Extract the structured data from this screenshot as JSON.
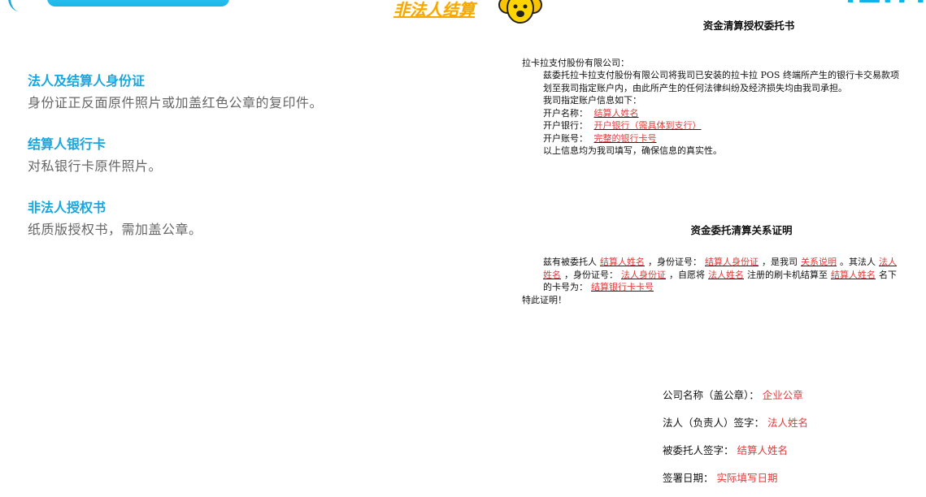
{
  "header": {
    "logo_text": "非法人结算",
    "right_fragment": "IEI7I"
  },
  "requirements": [
    {
      "title": "法人及结算人身份证",
      "desc": "身份证正反面原件照片或加盖红色公章的复印件。"
    },
    {
      "title": "结算人银行卡",
      "desc": "对私银行卡原件照片。"
    },
    {
      "title": "非法人授权书",
      "desc": "纸质版授权书，需加盖公章。"
    }
  ],
  "doc1": {
    "title": "资金清算授权委托书",
    "addressee": "拉卡拉支付股份有限公司：",
    "body": "兹委托拉卡拉支付股份有限公司将我司已安装的拉卡拉 POS 终端所产生的银行卡交易款项划至我司指定账户内，由此所产生的任何法律纠纷及经济损失均由我司承担。",
    "intro": "我司指定账户信息如下：",
    "fields": [
      {
        "label": "开户名称：",
        "value": "结算人姓名"
      },
      {
        "label": "开户银行：",
        "value": "开户银行（需具体到支行）"
      },
      {
        "label": "开户账号：",
        "value": "完整的银行卡号"
      }
    ],
    "closing": "以上信息均为我司填写，确保信息的真实性。"
  },
  "doc2": {
    "title": "资金委托清算关系证明",
    "t1": "兹有被委托人",
    "v1": "结算人姓名",
    "t2": "，身份证号：",
    "v2": "结算人身份证",
    "t3": "，是我司",
    "v3": "关系说明",
    "t4": "。其法人",
    "v4": "法人姓名",
    "t5": "，身份证号：",
    "v5": "法人身份证",
    "t6": "，自愿将",
    "v6": "法人姓名",
    "t7": "注册的刷卡机结算至",
    "v7": "结算人姓名",
    "t8": "名下的卡号为：",
    "v8": "结算银行卡卡号",
    "t9": "特此证明！"
  },
  "signatures": [
    {
      "label": "公司名称（盖公章）：",
      "value": "企业公章"
    },
    {
      "label": "法人（负责人）签字：",
      "value": "法人姓名"
    },
    {
      "label": "被委托人签字：",
      "value": "结算人姓名"
    },
    {
      "label": "签署日期：",
      "value": "实际填写日期"
    }
  ]
}
